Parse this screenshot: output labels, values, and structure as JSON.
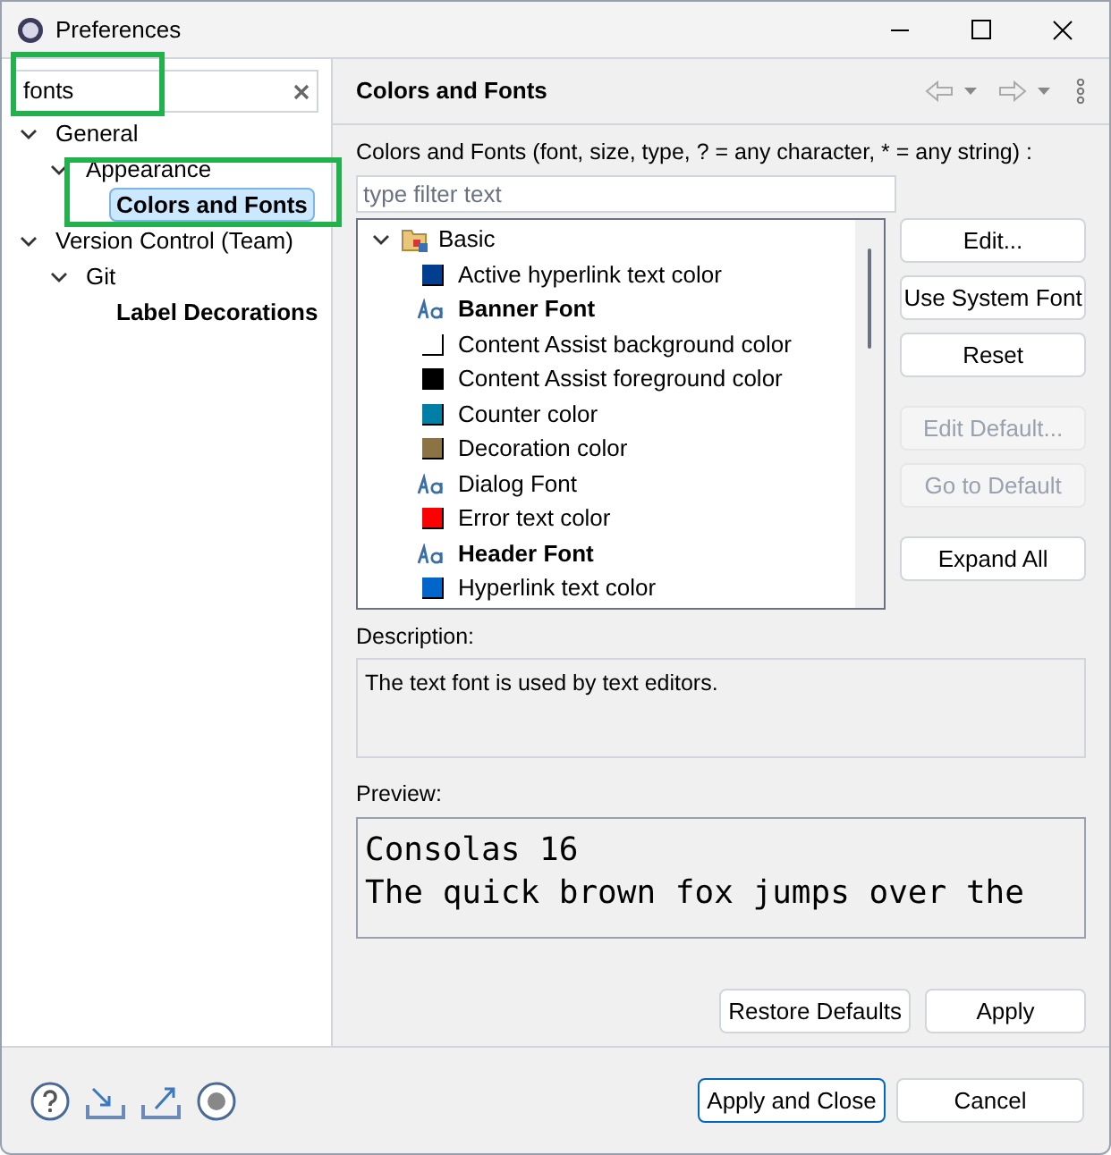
{
  "window": {
    "title": "Preferences"
  },
  "search": {
    "value": "fonts",
    "highlighted": true
  },
  "nav_tree": [
    {
      "label": "General",
      "expanded": true,
      "bold": false,
      "selected": false,
      "children": [
        {
          "label": "Appearance",
          "expanded": true,
          "bold": false,
          "selected": false,
          "children": [
            {
              "label": "Colors and Fonts",
              "bold": true,
              "selected": true,
              "highlighted": true
            }
          ]
        }
      ]
    },
    {
      "label": "Version Control (Team)",
      "expanded": true,
      "bold": false,
      "selected": false,
      "children": [
        {
          "label": "Git",
          "expanded": true,
          "bold": false,
          "selected": false,
          "children": [
            {
              "label": "Label Decorations",
              "bold": true,
              "selected": false
            }
          ]
        }
      ]
    }
  ],
  "page": {
    "title": "Colors and Fonts",
    "filter_label": "Colors and Fonts (font, size, type, ? = any character, * = any string) :",
    "filter_placeholder": "type filter text",
    "category": {
      "label": "Basic",
      "expanded": true
    },
    "items": [
      {
        "kind": "color",
        "label": "Active hyperlink text color",
        "color": "#003f8f",
        "bold": false
      },
      {
        "kind": "font",
        "label": "Banner Font",
        "bold": true
      },
      {
        "kind": "color",
        "label": "Content Assist background color",
        "color": "#ffffff",
        "bold": false
      },
      {
        "kind": "color",
        "label": "Content Assist foreground color",
        "color": "#000000",
        "bold": false
      },
      {
        "kind": "color",
        "label": "Counter color",
        "color": "#007fa6",
        "bold": false
      },
      {
        "kind": "color",
        "label": "Decoration color",
        "color": "#8b7344",
        "bold": false
      },
      {
        "kind": "font",
        "label": "Dialog Font",
        "bold": false
      },
      {
        "kind": "color",
        "label": "Error text color",
        "color": "#ff0000",
        "bold": false
      },
      {
        "kind": "font",
        "label": "Header Font",
        "bold": true
      },
      {
        "kind": "color",
        "label": "Hyperlink text color",
        "color": "#0066cc",
        "bold": false
      }
    ],
    "side_button_groups": [
      [
        {
          "label": "Edit...",
          "disabled": false
        },
        {
          "label": "Use System Font",
          "disabled": false
        },
        {
          "label": "Reset",
          "disabled": false
        }
      ],
      [
        {
          "label": "Edit Default...",
          "disabled": true
        },
        {
          "label": "Go to Default",
          "disabled": true
        }
      ],
      [
        {
          "label": "Expand All",
          "disabled": false
        }
      ]
    ],
    "description_label": "Description:",
    "description": "The text font is used by text editors.",
    "preview_label": "Preview:",
    "preview_lines": [
      "Consolas 16",
      "The quick brown fox jumps over the"
    ],
    "buttons": [
      "Restore Defaults",
      "Apply"
    ]
  },
  "footer_buttons": [
    {
      "label": "Apply and Close",
      "default": true
    },
    {
      "label": "Cancel",
      "default": false
    }
  ]
}
